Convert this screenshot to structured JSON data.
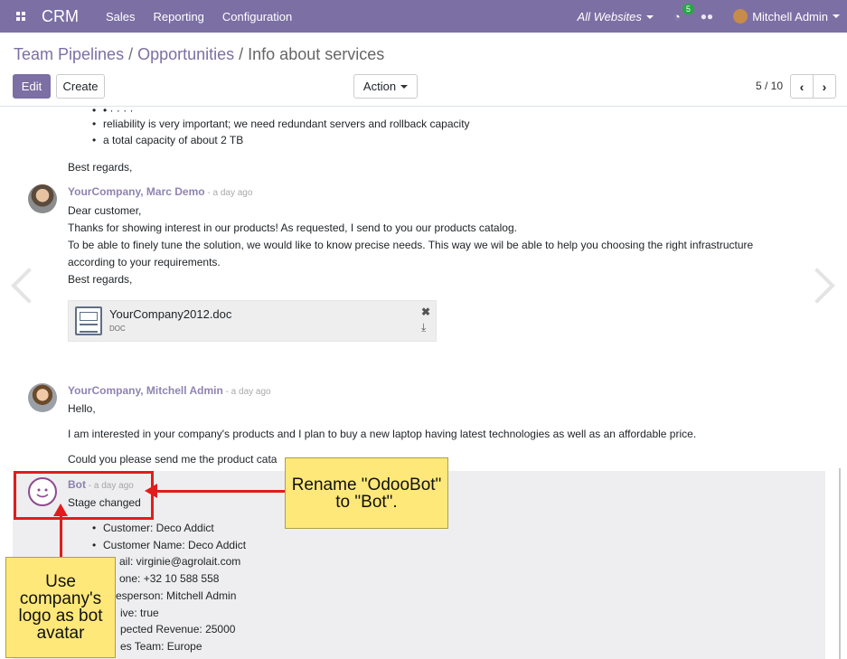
{
  "navbar": {
    "brand": "CRM",
    "menu": [
      "Sales",
      "Reporting",
      "Configuration"
    ],
    "websites": "All Websites",
    "activity_count": "5",
    "user": "Mitchell Admin"
  },
  "breadcrumb": {
    "part1": "Team Pipelines",
    "sep1": " / ",
    "part2": "Opportunities",
    "sep2": " / ",
    "current": "Info about services"
  },
  "toolbar": {
    "edit": "Edit",
    "create": "Create",
    "action": "Action",
    "pager": "5 / 10"
  },
  "chatter": {
    "top_bullets": [
      "reliability is very important; we need redundant servers and rollback capacity",
      "a total capacity of about 2 TB"
    ],
    "top_closing": "Best regards,",
    "msg1": {
      "author": "YourCompany, Marc Demo",
      "time": " - a day ago",
      "lines": [
        "Dear customer,",
        "Thanks for showing interest in our products! As requested, I send to you our products catalog.",
        "To be able to finely tune the solution, we would like to know precise needs. This way we wil be able to help you choosing the right infrastructure",
        "according to your requirements.",
        "Best regards,"
      ],
      "attachment": {
        "name": "YourCompany2012.doc",
        "type": "DOC"
      }
    },
    "msg2": {
      "author": "YourCompany, Mitchell Admin",
      "time": " - a day ago",
      "lines": [
        "Hello,",
        "I am interested in your company's products and I plan to buy a new laptop having latest technologies as well as an affordable price.",
        "Could you please send me the product cata"
      ]
    },
    "msg3": {
      "author": "Bot",
      "time": " - a day ago",
      "subject": "Stage changed",
      "bullets": [
        "Customer: Deco Addict",
        "Customer Name: Deco Addict",
        "ail: virginie@agrolait.com",
        "one: +32 10 588 558",
        "esperson: Mitchell Admin",
        "ive: true",
        "pected Revenue: 25000",
        "es Team: Europe"
      ]
    }
  },
  "annotations": {
    "rename": "Rename \"OdooBot\" to \"Bot\".",
    "logo": "Use company's logo as bot avatar"
  }
}
